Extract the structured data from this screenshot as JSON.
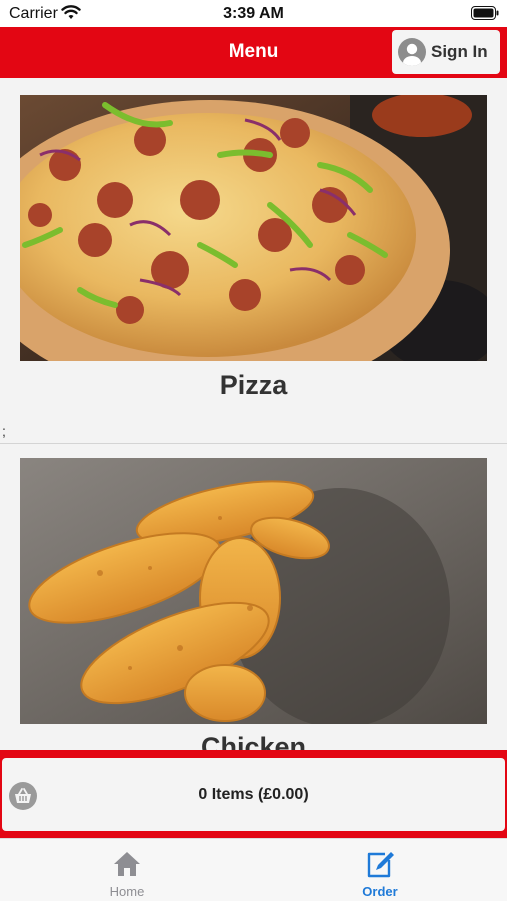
{
  "status_bar": {
    "carrier": "Carrier",
    "time": "3:39 AM"
  },
  "nav": {
    "title": "Menu",
    "sign_in_label": "Sign In"
  },
  "menu": {
    "categories": [
      {
        "label": "Pizza",
        "image": "pizza-photo"
      },
      {
        "label": "Chicken",
        "image": "chicken-strips-photo"
      }
    ],
    "separator_text": ";"
  },
  "basket": {
    "summary": "0 Items (£0.00)",
    "icon": "basket-icon"
  },
  "tabs": [
    {
      "label": "Home",
      "icon": "home-icon",
      "active": false
    },
    {
      "label": "Order",
      "icon": "edit-order-icon",
      "active": true
    }
  ],
  "colors": {
    "brand_red": "#e30613",
    "active_tab": "#1f7ad8",
    "inactive_tab": "#8e8e93"
  }
}
